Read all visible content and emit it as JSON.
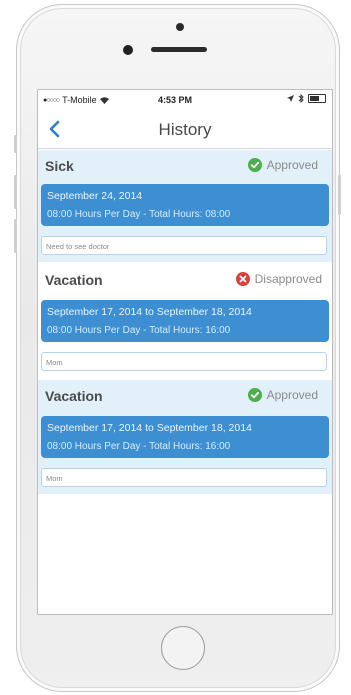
{
  "status_bar": {
    "carrier": "T-Mobile",
    "time": "4:53 PM"
  },
  "nav": {
    "back_icon": "chevron-left-icon",
    "title": "History"
  },
  "colors": {
    "accent": "#3d8fd1",
    "section_bg": "#e2f0fa",
    "approved": "#4cae4c",
    "disapproved": "#d9423a"
  },
  "requests": [
    {
      "type": "Sick",
      "status": "Approved",
      "status_icon": "check-circle-icon",
      "date_range": "September 24, 2014",
      "hours": "08:00 Hours Per Day - Total Hours: 08:00",
      "note": "Need to see doctor"
    },
    {
      "type": "Vacation",
      "status": "Disapproved",
      "status_icon": "x-circle-icon",
      "date_range": "September 17, 2014 to September 18, 2014",
      "hours": "08:00 Hours Per Day - Total Hours: 16:00",
      "note": "Mom"
    },
    {
      "type": "Vacation",
      "status": "Approved",
      "status_icon": "check-circle-icon",
      "date_range": "September 17, 2014 to September 18, 2014",
      "hours": "08:00 Hours Per Day - Total Hours: 16:00",
      "note": "Mom"
    }
  ]
}
